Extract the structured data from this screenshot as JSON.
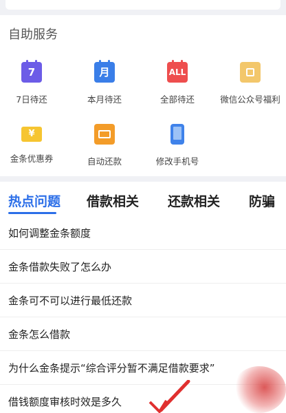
{
  "services": {
    "title": "自助服务",
    "items": [
      {
        "label": "7日待还",
        "icon": "calendar-7-icon",
        "glyph": "7"
      },
      {
        "label": "本月待还",
        "icon": "calendar-month-icon",
        "glyph": "月"
      },
      {
        "label": "全部待还",
        "icon": "calendar-all-icon",
        "glyph": "ALL"
      },
      {
        "label": "微信公众号福利",
        "icon": "gift-icon"
      },
      {
        "label": "金条优惠券",
        "icon": "coupon-icon",
        "glyph": "¥"
      },
      {
        "label": "自动还款",
        "icon": "autopay-card-icon"
      },
      {
        "label": "修改手机号",
        "icon": "phone-icon"
      }
    ]
  },
  "tabs": [
    {
      "label": "热点问题",
      "active": true
    },
    {
      "label": "借款相关",
      "active": false
    },
    {
      "label": "还款相关",
      "active": false
    },
    {
      "label": "防骗",
      "active": false
    }
  ],
  "faq": [
    "如何调整金条额度",
    "金条借款失败了怎么办",
    "金条可不可以进行最低还款",
    "金条怎么借款",
    "为什么金条提示“综合评分暂不满足借款要求”",
    "借钱额度审核时效是多久"
  ],
  "colors": {
    "accent": "#2b6ee8",
    "calendar_purple": "#6c5ce7",
    "calendar_blue": "#3a7ee8",
    "calendar_red": "#ee4e4e",
    "gift_yellow": "#f3c76b",
    "coupon_yellow": "#f6c531",
    "autopay_orange": "#f39c29"
  }
}
